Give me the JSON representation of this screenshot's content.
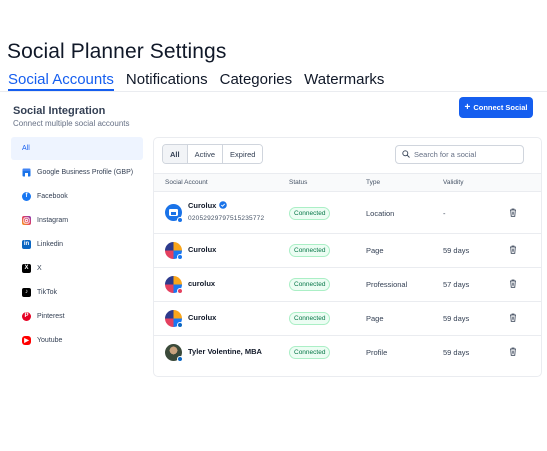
{
  "page": {
    "title": "Social Planner Settings"
  },
  "tabs": [
    {
      "label": "Social Accounts",
      "active": true
    },
    {
      "label": "Notifications",
      "active": false
    },
    {
      "label": "Categories",
      "active": false
    },
    {
      "label": "Watermarks",
      "active": false
    }
  ],
  "integration": {
    "title": "Social Integration",
    "subtitle": "Connect multiple social accounts",
    "connect_label": "Connect Social"
  },
  "sidebar": {
    "items": [
      {
        "label": "All",
        "icon": "all",
        "active": true
      },
      {
        "label": "Google Business Profile (GBP)",
        "icon": "gbp-icon"
      },
      {
        "label": "Facebook",
        "icon": "facebook-icon"
      },
      {
        "label": "Instagram",
        "icon": "instagram-icon"
      },
      {
        "label": "Linkedin",
        "icon": "linkedin-icon"
      },
      {
        "label": "X",
        "icon": "x-icon"
      },
      {
        "label": "TikTok",
        "icon": "tiktok-icon"
      },
      {
        "label": "Pinterest",
        "icon": "pinterest-icon"
      },
      {
        "label": "Youtube",
        "icon": "youtube-icon"
      }
    ]
  },
  "filters": [
    {
      "label": "All",
      "active": true
    },
    {
      "label": "Active",
      "active": false
    },
    {
      "label": "Expired",
      "active": false
    }
  ],
  "search": {
    "placeholder": "Search for a social"
  },
  "table": {
    "headers": {
      "account": "Social Account",
      "status": "Status",
      "type": "Type",
      "validity": "Validity"
    },
    "rows": [
      {
        "name": "Curolux",
        "id": "02052929797515235772",
        "verified": true,
        "status": "Connected",
        "type": "Location",
        "validity": "-",
        "network": "gbp"
      },
      {
        "name": "Curolux",
        "id": "",
        "status": "Connected",
        "type": "Page",
        "validity": "59 days",
        "network": "facebook"
      },
      {
        "name": "curolux",
        "id": "",
        "status": "Connected",
        "type": "Professional",
        "validity": "57 days",
        "network": "instagram"
      },
      {
        "name": "Curolux",
        "id": "",
        "status": "Connected",
        "type": "Page",
        "validity": "59 days",
        "network": "linkedin"
      },
      {
        "name": "Tyler Volentine, MBA",
        "id": "",
        "status": "Connected",
        "type": "Profile",
        "validity": "59 days",
        "network": "linkedin"
      }
    ]
  },
  "colors": {
    "accent": "#155eef",
    "success_text": "#067647",
    "success_bg": "#ecfdf3"
  }
}
